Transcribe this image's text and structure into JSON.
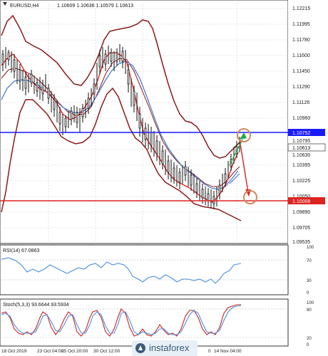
{
  "header": {
    "symbol": "EURUSD,H4",
    "ohlc": "1.10609 1.10636 1.10579 1.10613"
  },
  "price_axis": {
    "labels": [
      "1.12215",
      "1.11995",
      "1.11780",
      "1.11600",
      "1.11450",
      "1.11290",
      "1.11126",
      "1.10960",
      "1.10795",
      "1.10630",
      "1.10395",
      "1.10225",
      "1.10050",
      "1.09890",
      "1.09705",
      "1.09535"
    ],
    "current_price_label": "1.10613",
    "resistance_label": "1.10752",
    "support_label": "1.10008"
  },
  "time_axis": {
    "labels": [
      "18 Oct 2019",
      "23 Oct 04:00",
      "25 Oct 20:00",
      "30 Oct 12:00",
      "0",
      "14 Nov 04:00"
    ]
  },
  "rsi": {
    "title": "RSI(14) 67.0863",
    "levels": [
      "100",
      "70",
      "30",
      "0"
    ]
  },
  "stoch": {
    "title": "Stoch(5,3,3) 93.6644 93.5934",
    "levels": [
      "100",
      "80",
      "20",
      "0"
    ]
  },
  "watermark": {
    "text": "instaforex"
  },
  "colors": {
    "resistance_line": "#1a1aff",
    "support_line": "#dd2222",
    "bands": "#8b1a1a",
    "ma_fast": "#e02020",
    "ma_slow": "#4a7fd0",
    "rsi_line": "#4a90e2",
    "arrow_up": "#22aa44",
    "arrow_down": "#dd2222",
    "circle": "#d08a60"
  }
}
